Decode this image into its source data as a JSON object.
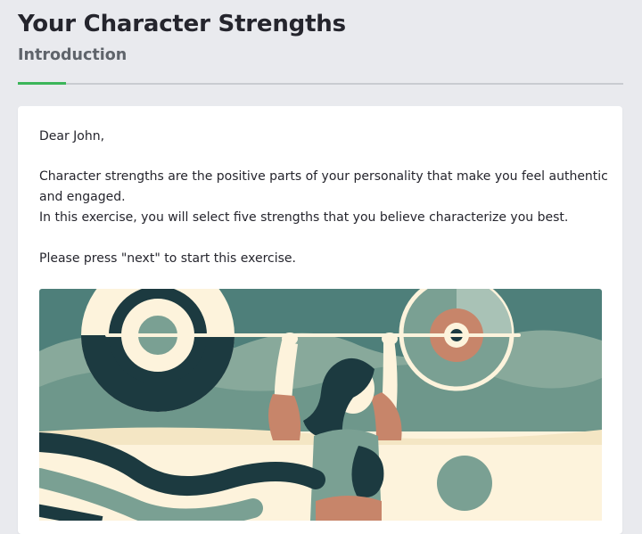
{
  "header": {
    "title": "Your Character Strengths",
    "subtitle": "Introduction",
    "progress_fraction": 0.08
  },
  "intro": {
    "greeting": "Dear John,",
    "paragraph1": "Character strengths are the positive parts of your personality that make you feel authentic and engaged.",
    "paragraph2": "In this exercise, you will select five strengths that you believe characterize you best.",
    "instruction": "Please press \"next\" to start this exercise."
  },
  "colors": {
    "accent_green": "#3cb55a",
    "teal": "#4d7d78",
    "sage": "#7aa093",
    "cream": "#fdf3dc",
    "navy": "#1c3a40",
    "terracotta": "#c7856a"
  },
  "illustration": {
    "icon": "weightlifter-illustration"
  }
}
